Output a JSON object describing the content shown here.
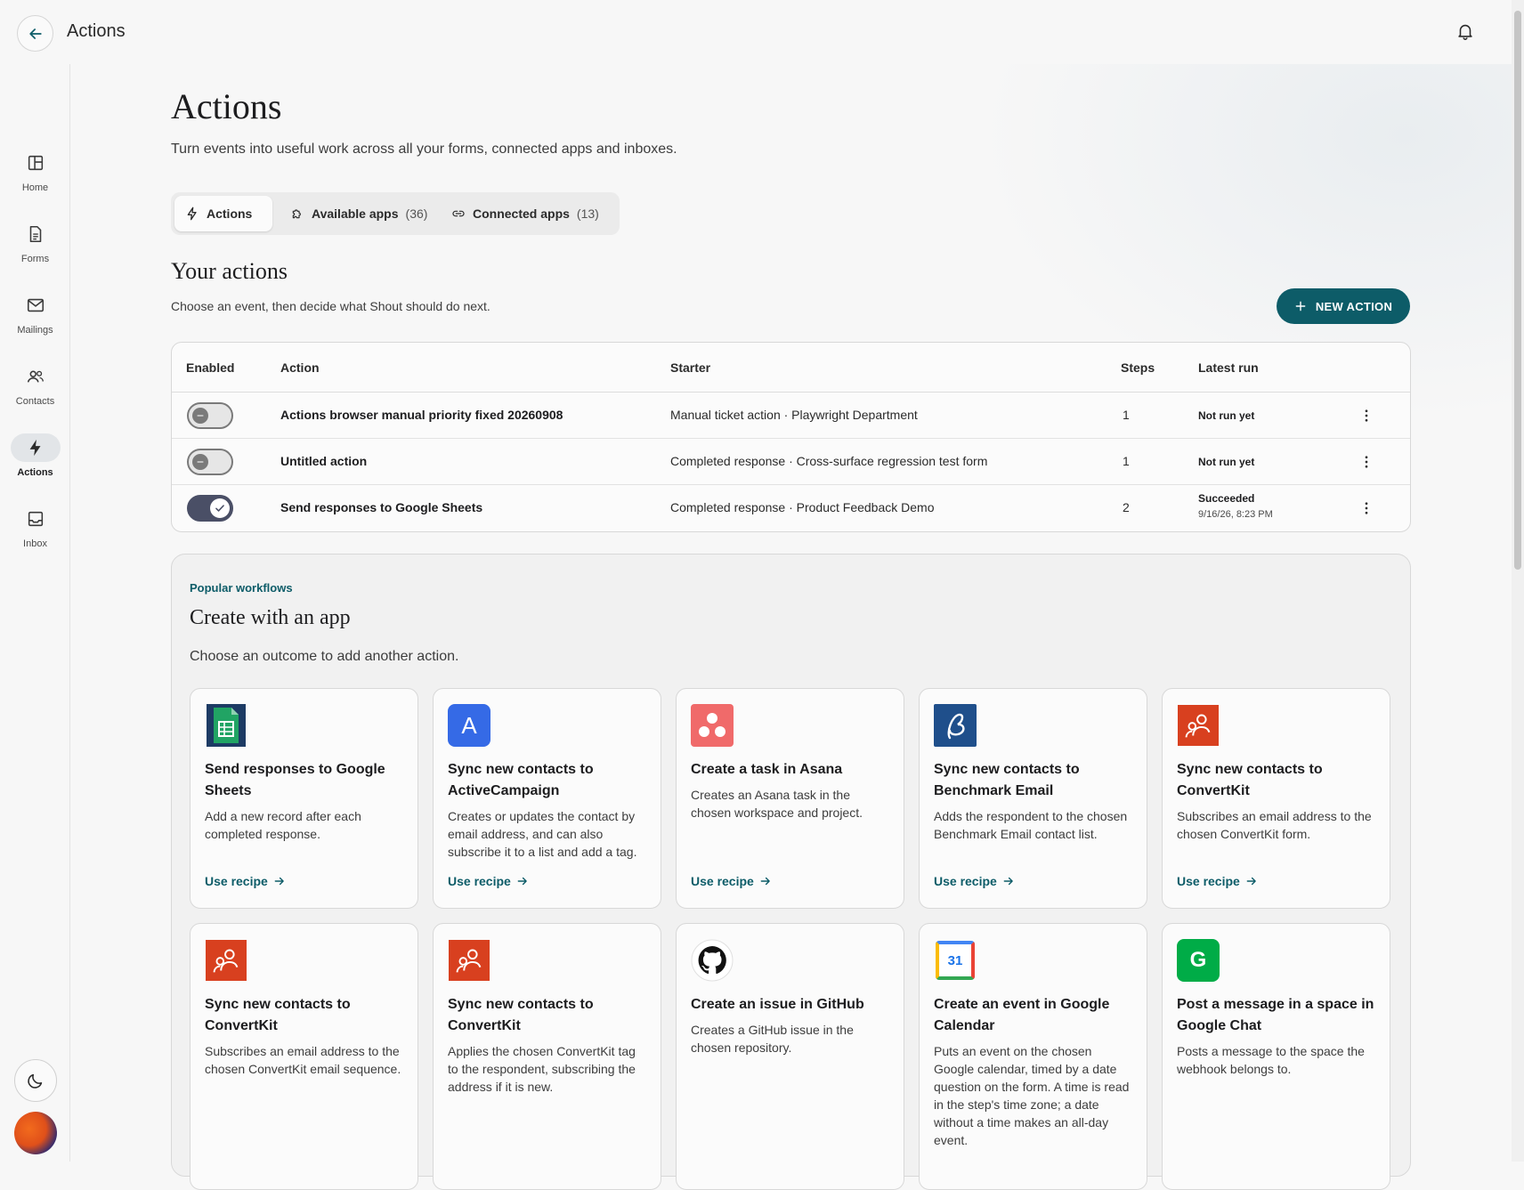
{
  "topbar": {
    "title": "Actions"
  },
  "sidebar": {
    "items": [
      {
        "label": "Home",
        "icon": "home-icon"
      },
      {
        "label": "Forms",
        "icon": "forms-icon"
      },
      {
        "label": "Mailings",
        "icon": "mail-icon"
      },
      {
        "label": "Contacts",
        "icon": "contacts-icon"
      },
      {
        "label": "Actions",
        "icon": "lightning-icon",
        "active": true
      },
      {
        "label": "Inbox",
        "icon": "inbox-icon"
      }
    ]
  },
  "page": {
    "title": "Actions",
    "subtitle": "Turn events into useful work across all your forms, connected apps and inboxes."
  },
  "tabs": [
    {
      "label": "Actions",
      "count": "",
      "active": true
    },
    {
      "label": "Available apps",
      "count": "(36)"
    },
    {
      "label": "Connected apps",
      "count": "(13)"
    }
  ],
  "your_actions": {
    "title": "Your actions",
    "subtitle": "Choose an event, then decide what Shout should do next.",
    "new_button": "NEW ACTION",
    "columns": {
      "enabled": "Enabled",
      "action": "Action",
      "starter": "Starter",
      "steps": "Steps",
      "latest": "Latest run"
    },
    "rows": [
      {
        "enabled": false,
        "action": "Actions browser manual priority fixed 20260908",
        "starter": "Manual ticket action · Playwright Department",
        "steps": "1",
        "latest": "Not run yet",
        "latest_time": ""
      },
      {
        "enabled": false,
        "action": "Untitled action",
        "starter": "Completed response · Cross-surface regression test form",
        "steps": "1",
        "latest": "Not run yet",
        "latest_time": ""
      },
      {
        "enabled": true,
        "action": "Send responses to Google Sheets",
        "starter": "Completed response · Product Feedback Demo",
        "steps": "2",
        "latest": "Succeeded",
        "latest_time": "9/16/26, 8:23 PM"
      }
    ]
  },
  "popular": {
    "kicker": "Popular workflows",
    "title": "Create with an app",
    "subtitle": "Choose an outcome to add another action.",
    "recipe_label": "Use recipe",
    "cards": [
      {
        "title": "Send responses to Google Sheets",
        "desc": "Add a new record after each completed response.",
        "logo": "google-sheets-logo",
        "color": "#188038"
      },
      {
        "title": "Sync new contacts to ActiveCampaign",
        "desc": "Creates or updates the contact by email address, and can also subscribe it to a list and add a tag.",
        "logo": "activecampaign-logo",
        "color": "#356ae6",
        "logo_text": "A"
      },
      {
        "title": "Create a task in Asana",
        "desc": "Creates an Asana task in the chosen workspace and project.",
        "logo": "asana-logo",
        "color": "#f06a6a"
      },
      {
        "title": "Sync new contacts to Benchmark Email",
        "desc": "Adds the respondent to the chosen Benchmark Email contact list.",
        "logo": "benchmark-logo",
        "color": "#1f4f8b"
      },
      {
        "title": "Sync new contacts to ConvertKit",
        "desc": "Subscribes an email address to the chosen ConvertKit form.",
        "logo": "convertkit-logo",
        "color": "#d8401f"
      },
      {
        "title": "Sync new contacts to ConvertKit",
        "desc": "Subscribes an email address to the chosen ConvertKit email sequence.",
        "logo": "convertkit-logo",
        "color": "#d8401f"
      },
      {
        "title": "Sync new contacts to ConvertKit",
        "desc": "Applies the chosen ConvertKit tag to the respondent, subscribing the address if it is new.",
        "logo": "convertkit-logo",
        "color": "#d8401f"
      },
      {
        "title": "Create an issue in GitHub",
        "desc": "Creates a GitHub issue in the chosen repository.",
        "logo": "github-logo",
        "color": "#111111"
      },
      {
        "title": "Create an event in Google Calendar",
        "desc": "Puts an event on the chosen Google calendar, timed by a date question on the form. A time is read in the step's time zone; a date without a time makes an all-day event.",
        "logo": "google-calendar-logo",
        "color": "#4285f4",
        "logo_text": "31"
      },
      {
        "title": "Post a message in a space in Google Chat",
        "desc": "Posts a message to the space the webhook belongs to.",
        "logo": "google-chat-logo",
        "color": "#00ac47",
        "logo_text": "G"
      }
    ]
  },
  "colors": {
    "accent": "#0d5c68",
    "toggle_on": "#4a4f66"
  }
}
